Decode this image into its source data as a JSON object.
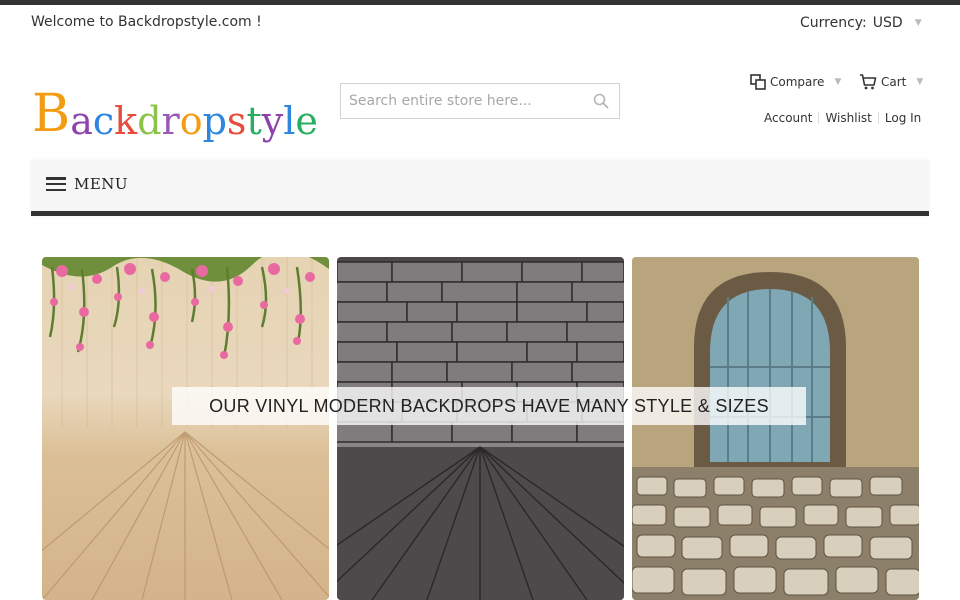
{
  "header": {
    "welcome": "Welcome to Backdropstyle.com !",
    "currency_label": "Currency:",
    "currency_value": "USD"
  },
  "logo": {
    "letters": [
      {
        "ch": "B",
        "color": "#f39c12",
        "size": "big"
      },
      {
        "ch": "a",
        "color": "#8e44ad",
        "size": "sm"
      },
      {
        "ch": "c",
        "color": "#2e86de",
        "size": "sm"
      },
      {
        "ch": "k",
        "color": "#e74c3c",
        "size": "sm"
      },
      {
        "ch": "d",
        "color": "#8bc34a",
        "size": "sm"
      },
      {
        "ch": "r",
        "color": "#9b59b6",
        "size": "sm"
      },
      {
        "ch": "o",
        "color": "#f39c12",
        "size": "sm"
      },
      {
        "ch": "p",
        "color": "#2e86de",
        "size": "sm"
      },
      {
        "ch": "s",
        "color": "#e74c3c",
        "size": "sm"
      },
      {
        "ch": "t",
        "color": "#27ae60",
        "size": "sm"
      },
      {
        "ch": "y",
        "color": "#8e44ad",
        "size": "sm"
      },
      {
        "ch": "l",
        "color": "#2e86de",
        "size": "sm"
      },
      {
        "ch": "e",
        "color": "#27ae60",
        "size": "sm"
      }
    ]
  },
  "search": {
    "placeholder": "Search entire store here..."
  },
  "actions": {
    "compare": "Compare",
    "cart": "Cart",
    "account": "Account",
    "wishlist": "Wishlist",
    "login": "Log In"
  },
  "menu": {
    "label": "MENU"
  },
  "banner": {
    "caption": "OUR VINYL MODERN BACKDROPS HAVE MANY STYLE & SIZES"
  },
  "colors": {
    "topbar": "#333333",
    "menu_border": "#333333"
  }
}
